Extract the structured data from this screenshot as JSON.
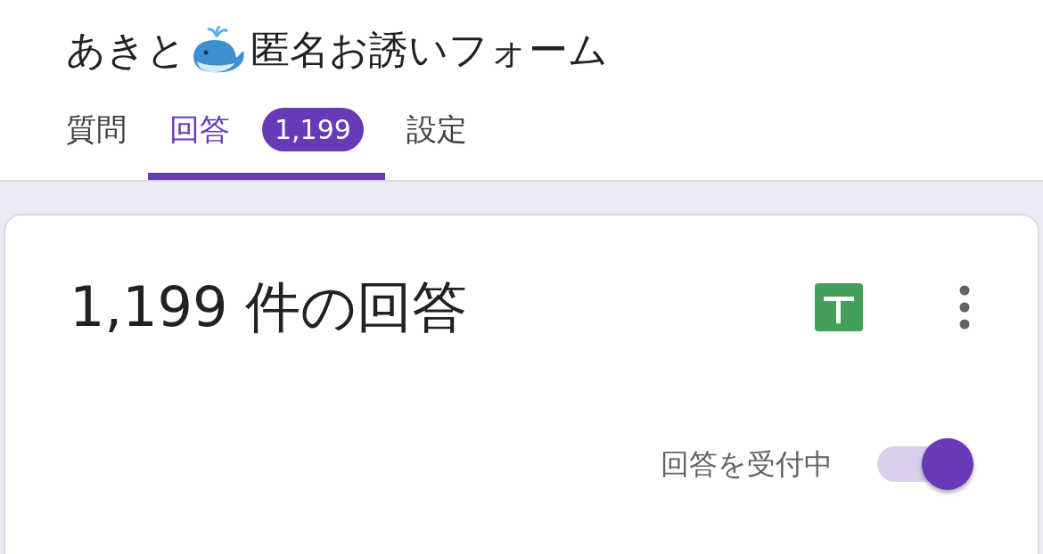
{
  "title": {
    "before": "あきと",
    "after": "匿名お誘いフォーム"
  },
  "tabs": [
    {
      "label": "質問",
      "selected": false
    },
    {
      "label": "回答",
      "selected": true,
      "badge": "1,199"
    },
    {
      "label": "設定",
      "selected": false
    }
  ],
  "summary": {
    "heading": "1,199 件の回答",
    "accepting_label": "回答を受付中",
    "accepting": true
  }
}
